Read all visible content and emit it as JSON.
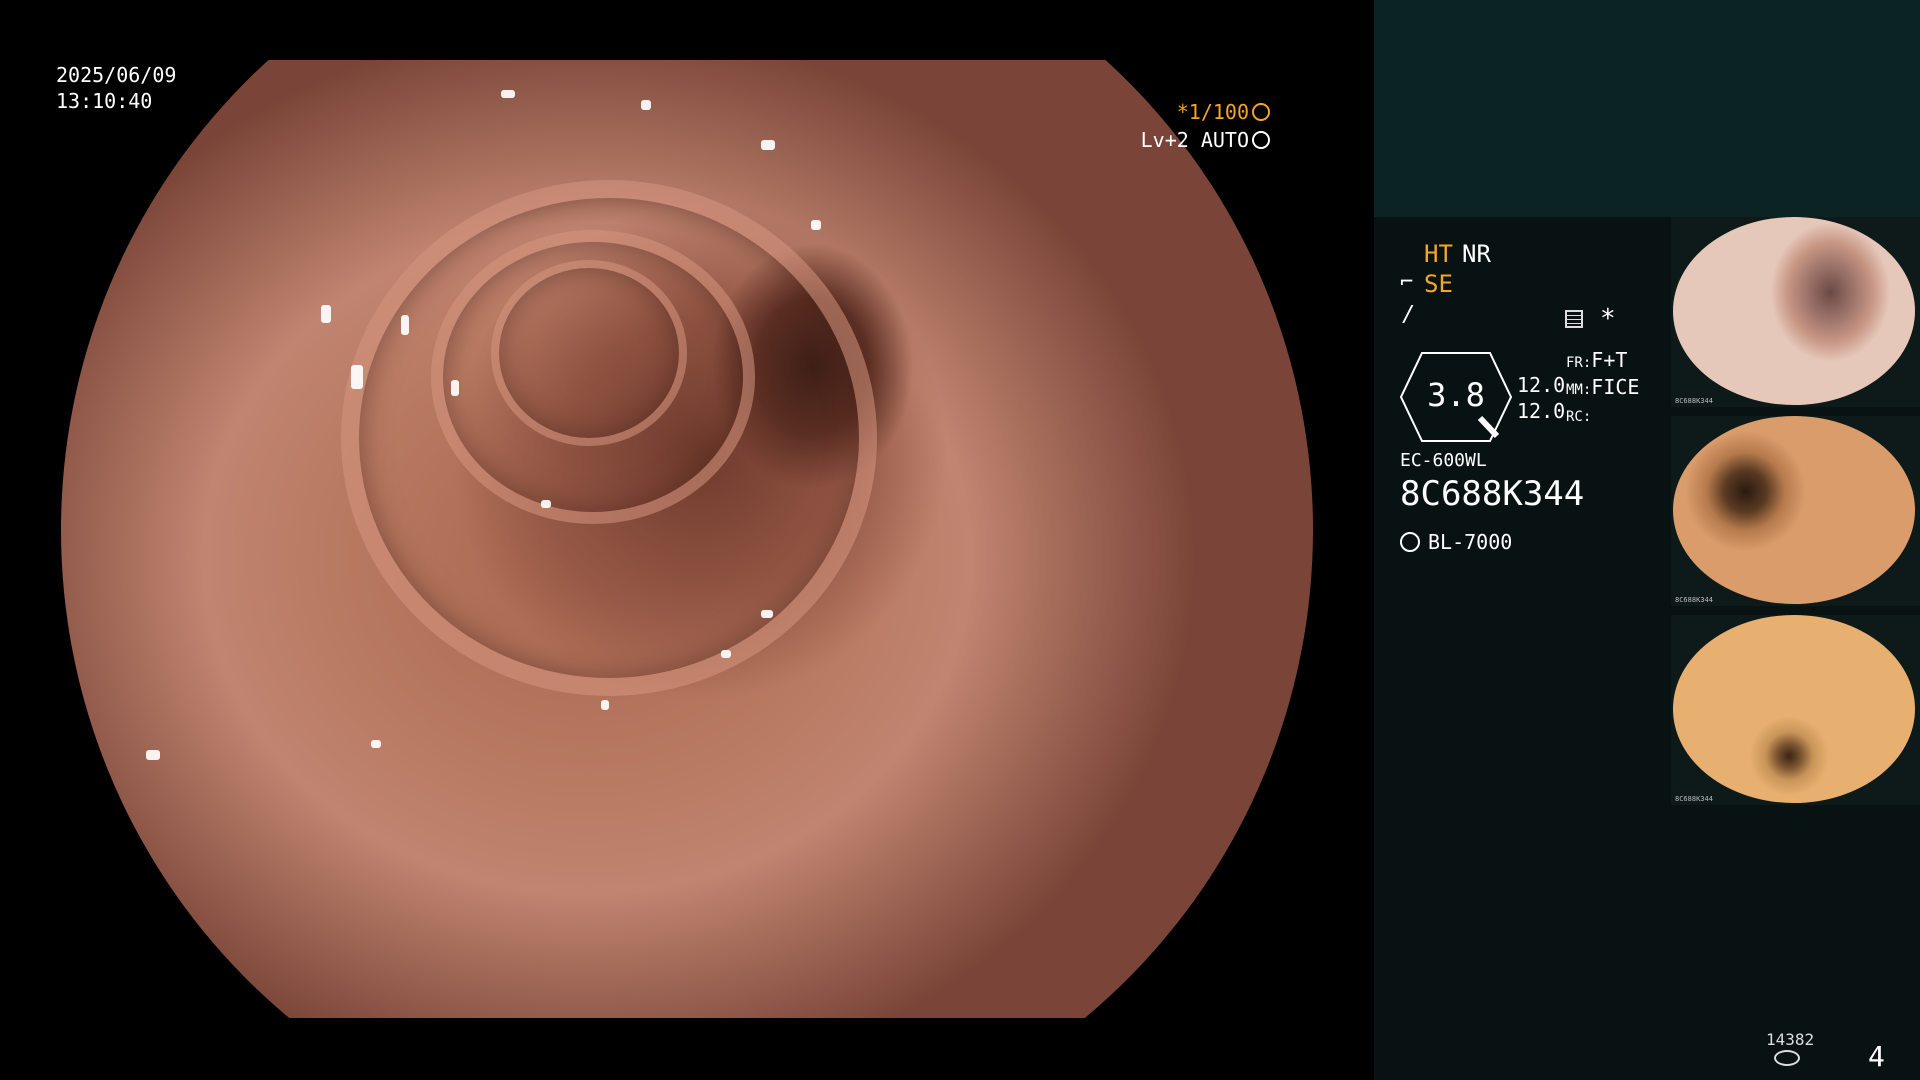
{
  "overlay": {
    "date": "2025/06/09",
    "time": "13:10:40",
    "shutter_value": "*1/100",
    "level_label": "Lv+2 AUTO"
  },
  "panel": {
    "ht": "HT",
    "nr": "NR",
    "se": "SE",
    "zoom_value": "3.8",
    "zoom_a": "12.0",
    "zoom_b": "12.0",
    "fr_label": "FR:",
    "fr_value": "F+T",
    "mm_label": "MM:",
    "mm_value": "FICE",
    "rc_label": "RC:",
    "scope_model": "EC-600WL",
    "scope_serial": "8C688K344",
    "light_source": "BL-7000",
    "disk_count": "14382",
    "page_number": "4"
  },
  "thumbnails": [
    {
      "caption": "8C688K344"
    },
    {
      "caption": "8C688K344"
    },
    {
      "caption": "8C688K344"
    }
  ],
  "colors": {
    "accent_orange": "#f5a623",
    "panel_top": "#0c2323",
    "panel_bottom": "#081212"
  },
  "icons": [
    "shutter-wheel-icon",
    "auto-ring-icon",
    "se-icon",
    "slash-icon",
    "menu-icon",
    "star-icon",
    "magnifier-icon",
    "sun-icon",
    "disk-icon"
  ]
}
